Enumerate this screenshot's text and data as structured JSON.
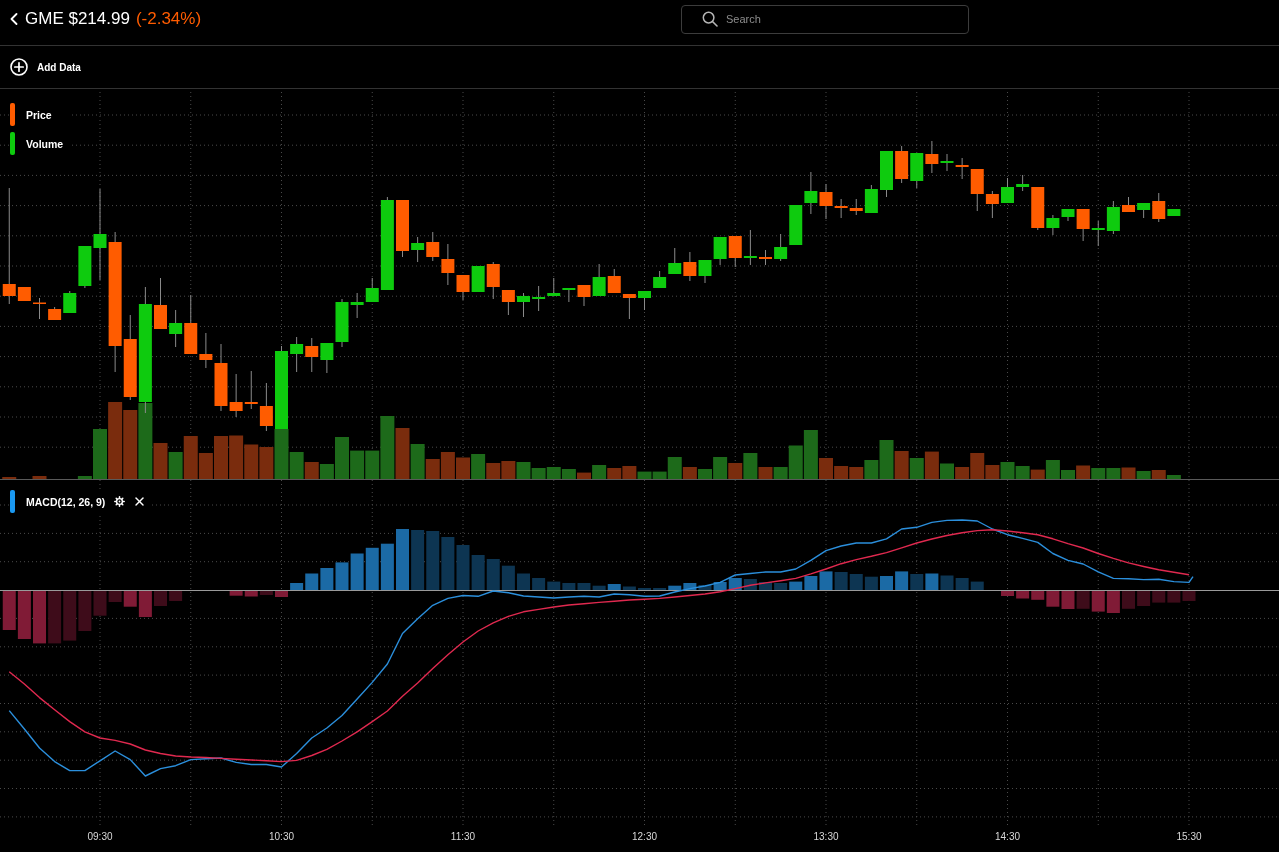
{
  "header": {
    "title": "GME $214.99",
    "change": "(-2.34%)"
  },
  "search": {
    "placeholder": "Search"
  },
  "toolbar": {
    "add_button": "Add Data"
  },
  "price_panel": {
    "legend": [
      {
        "label": "Price",
        "color": "#ff5c00"
      },
      {
        "label": "Volume",
        "color": "#0ecb0e"
      }
    ]
  },
  "macd_panel": {
    "legend": {
      "label": "MACD(12, 26, 9)",
      "color": "#1a98f0"
    }
  },
  "time_axis": {
    "labels": [
      "09:30",
      "10:30",
      "11:30",
      "12:30",
      "13:30",
      "14:30",
      "15:30"
    ]
  }
}
